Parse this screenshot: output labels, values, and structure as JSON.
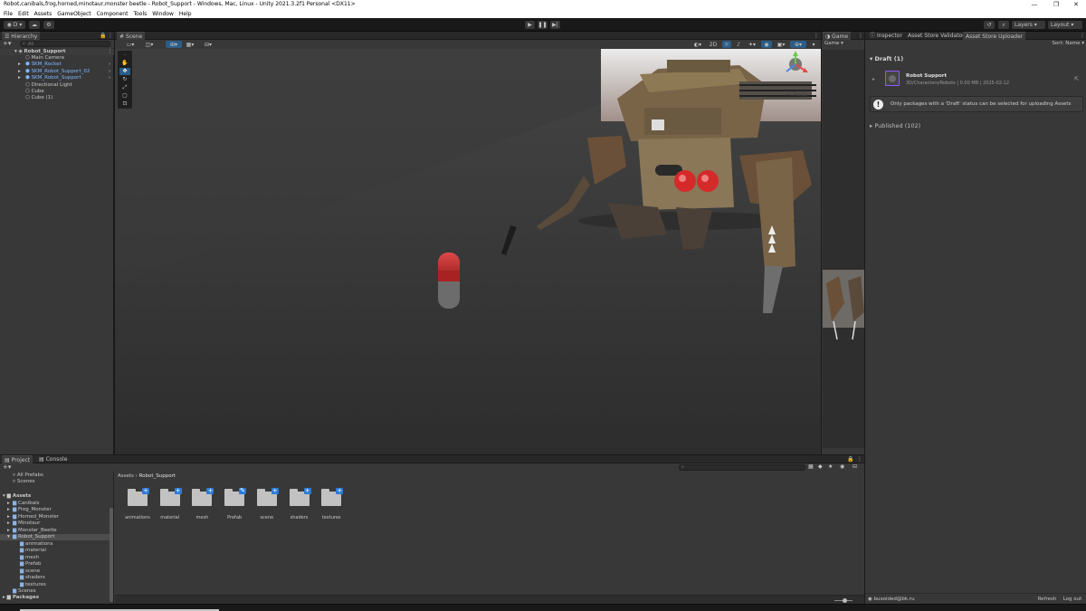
{
  "window": {
    "title": "Robot,canibals,frog,horned,minotaur,monster beetle - Robot_Support - Windows, Mac, Linux - Unity 2021.3.2f1 Personal <DX11>"
  },
  "menu": [
    "File",
    "Edit",
    "Assets",
    "GameObject",
    "Component",
    "Tools",
    "Window",
    "Help"
  ],
  "toolbar": {
    "account": "D",
    "layers": "Layers",
    "layout": "Layout"
  },
  "hierarchy": {
    "tab": "Hierarchy",
    "search_placeholder": "All",
    "scene": "Robot_Support",
    "items": [
      {
        "label": "Main Camera",
        "prefab": false,
        "expand": false,
        "level": 1
      },
      {
        "label": "SKM_Rocket",
        "prefab": true,
        "expand": true,
        "level": 1
      },
      {
        "label": "SKM_Robot_Support_02",
        "prefab": true,
        "expand": true,
        "level": 1
      },
      {
        "label": "SKM_Robot_Support",
        "prefab": true,
        "expand": true,
        "level": 1
      },
      {
        "label": "Directional Light",
        "prefab": false,
        "expand": false,
        "level": 1
      },
      {
        "label": "Cube",
        "prefab": false,
        "expand": false,
        "level": 1
      },
      {
        "label": "Cube (1)",
        "prefab": false,
        "expand": false,
        "level": 1
      }
    ]
  },
  "scene": {
    "tab": "Scene",
    "mode_2d": "2D",
    "gizmo_label": "< Persp"
  },
  "game": {
    "tab": "Game",
    "display": "Game"
  },
  "inspector": {
    "tabs": [
      "Inspector",
      "Asset Store Validator",
      "Asset Store Uploader"
    ],
    "sort": "Sort: Name",
    "draft_header": "Draft (1)",
    "package_name": "Robot Support",
    "package_info": "3D/Characters/Robots | 0.00 MB | 2025-02-12",
    "notice": "Only packages with a 'Draft' status can be selected for uploading Assets",
    "published_header": "Published (102)",
    "user": "buxolded@bk.ru",
    "refresh": "Refresh",
    "logout": "Log out"
  },
  "project": {
    "tabs": [
      "Project",
      "Console"
    ],
    "favorites": [
      "All Prefabs",
      "Scenes"
    ],
    "assets_label": "Assets",
    "tree": [
      {
        "label": "Canibals",
        "level": 1
      },
      {
        "label": "Frog_Monster",
        "level": 1
      },
      {
        "label": "Horned_Monster",
        "level": 1
      },
      {
        "label": "Minotaur",
        "level": 1
      },
      {
        "label": "Monster_Beetle",
        "level": 1
      },
      {
        "label": "Robot_Support",
        "level": 1,
        "selected": true
      },
      {
        "label": "animations",
        "level": 2
      },
      {
        "label": "material",
        "level": 2
      },
      {
        "label": "mesh",
        "level": 2
      },
      {
        "label": "Prefab",
        "level": 2
      },
      {
        "label": "scene",
        "level": 2
      },
      {
        "label": "shaders",
        "level": 2
      },
      {
        "label": "textures",
        "level": 2
      },
      {
        "label": "Scenes",
        "level": 1
      }
    ],
    "packages_label": "Packages",
    "breadcrumb": [
      "Assets",
      "Robot_Support"
    ],
    "folders": [
      "animations",
      "material",
      "mesh",
      "Prefab",
      "scene",
      "shaders",
      "textures"
    ]
  },
  "colors": {
    "accent": "#2c5d87",
    "prefab_blue": "#7fb7ff",
    "badge_blue": "#2b7bd6",
    "robot_red": "#d42a2a"
  }
}
